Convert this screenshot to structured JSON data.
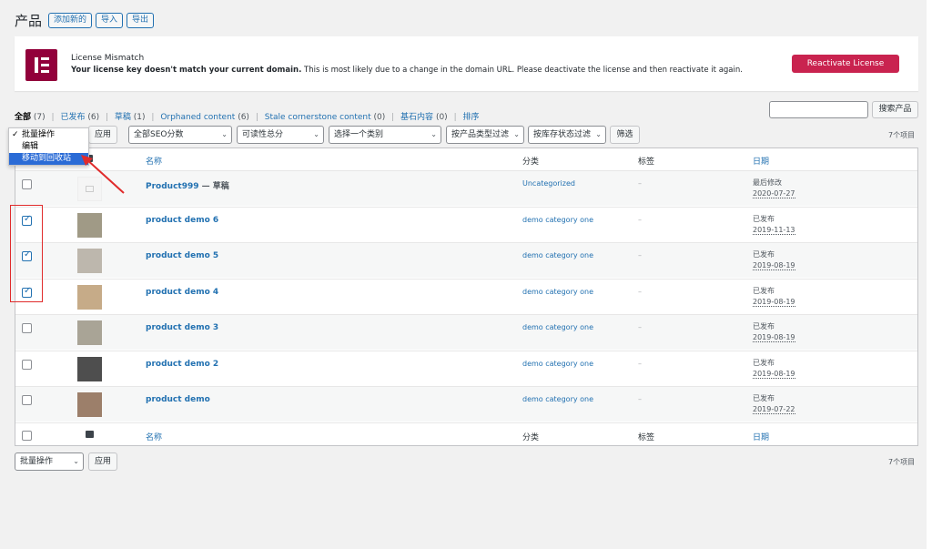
{
  "header": {
    "title": "产品",
    "buttons": [
      "添加新的",
      "导入",
      "导出"
    ]
  },
  "notice": {
    "title": "License Mismatch",
    "text_bold": "Your license key doesn't match your current domain.",
    "text_rest": " This is most likely due to a change in the domain URL. Please deactivate the license and then reactivate it again.",
    "button": "Reactivate License",
    "brand_color": "#92003b",
    "button_color": "#c9234f"
  },
  "filters": {
    "links": [
      {
        "label": "全部",
        "count": "(7)"
      },
      {
        "label": "已发布",
        "count": "(6)"
      },
      {
        "label": "草稿",
        "count": "(1)"
      },
      {
        "label": "Orphaned content",
        "count": "(6)"
      },
      {
        "label": "Stale cornerstone content",
        "count": "(0)"
      },
      {
        "label": "基石内容",
        "count": "(0)"
      },
      {
        "label": "排序",
        "count": ""
      }
    ],
    "separator": "|"
  },
  "search": {
    "button": "搜索产品"
  },
  "toolbar": {
    "bulk_action": "批量操作",
    "apply": "应用",
    "seo": "全部SEO分数",
    "readability": "可读性总分",
    "category": "选择一个类别",
    "product_type": "按产品类型过滤",
    "stock": "按库存状态过滤",
    "filter": "筛选",
    "count": "7个项目"
  },
  "bulk_dropdown": {
    "checkmark": "✓",
    "options": [
      "批量操作",
      "编辑",
      "移动到回收站"
    ],
    "highlighted_index": 2
  },
  "table": {
    "columns": {
      "name": "名称",
      "category": "分类",
      "tags": "标签",
      "date": "日期"
    },
    "rows": [
      {
        "name": "Product999",
        "suffix": " — 草稿",
        "category": "Uncategorized",
        "tags": "–",
        "status": "最后修改",
        "date": "2020-07-27",
        "checked": false,
        "thumb_color": "#f0f0f0"
      },
      {
        "name": "product demo 6",
        "suffix": "",
        "category": "demo category one",
        "tags": "–",
        "status": "已发布",
        "date": "2019-11-13",
        "checked": true,
        "thumb_color": "#a09a86"
      },
      {
        "name": "product demo 5",
        "suffix": "",
        "category": "demo category one",
        "tags": "–",
        "status": "已发布",
        "date": "2019-08-19",
        "checked": true,
        "thumb_color": "#bdb7ad"
      },
      {
        "name": "product demo 4",
        "suffix": "",
        "category": "demo category one",
        "tags": "–",
        "status": "已发布",
        "date": "2019-08-19",
        "checked": true,
        "thumb_color": "#c6ab88"
      },
      {
        "name": "product demo 3",
        "suffix": "",
        "category": "demo category one",
        "tags": "–",
        "status": "已发布",
        "date": "2019-08-19",
        "checked": false,
        "thumb_color": "#a9a496"
      },
      {
        "name": "product demo 2",
        "suffix": "",
        "category": "demo category one",
        "tags": "–",
        "status": "已发布",
        "date": "2019-08-19",
        "checked": false,
        "thumb_color": "#4e4e4e"
      },
      {
        "name": "product demo",
        "suffix": "",
        "category": "demo category one",
        "tags": "–",
        "status": "已发布",
        "date": "2019-07-22",
        "checked": false,
        "thumb_color": "#9c7f6a"
      }
    ]
  },
  "bottom_toolbar": {
    "bulk_action": "批量操作",
    "apply": "应用",
    "count": "7个项目"
  },
  "annotation_color": "#e02b2b"
}
